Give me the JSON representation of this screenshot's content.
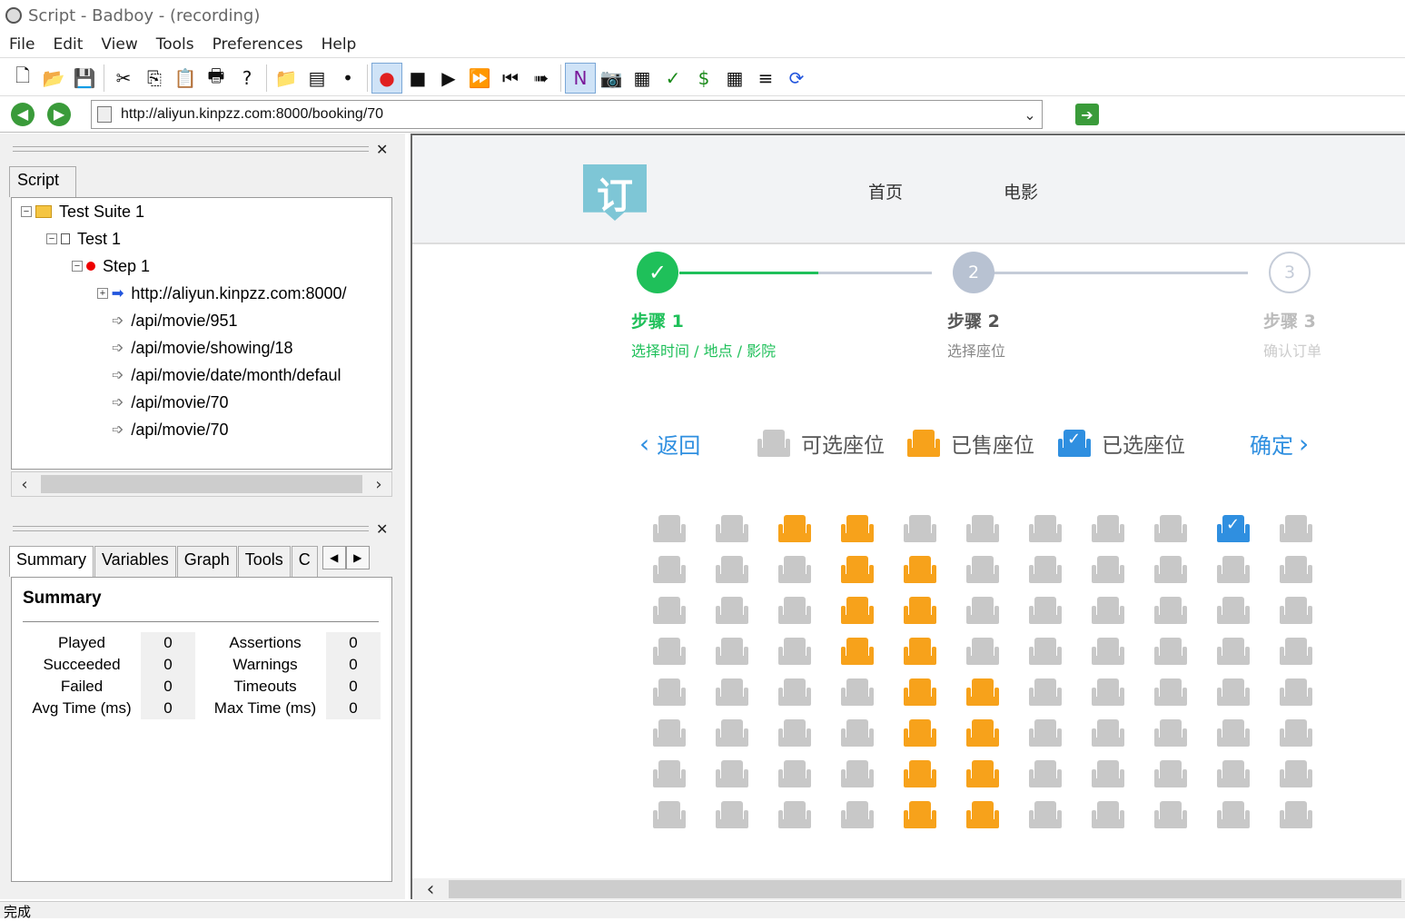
{
  "window": {
    "title": "Script - Badboy - (recording)"
  },
  "menu": [
    "File",
    "Edit",
    "View",
    "Tools",
    "Preferences",
    "Help"
  ],
  "toolbar": {
    "icons": [
      "new-file-icon",
      "open-folder-icon",
      "save-icon",
      "cut-icon",
      "copy-icon",
      "paste-icon",
      "print-icon",
      "help-icon",
      "add-folder-icon",
      "add-test-icon",
      "add-step-icon",
      "record-icon",
      "stop-icon",
      "play-icon",
      "fast-forward-icon",
      "rewind-icon",
      "step-forward-icon",
      "navigation-icon",
      "screenshot-icon",
      "form-icon",
      "check-icon",
      "dollar-icon",
      "table-icon",
      "report-icon",
      "refresh-icon"
    ],
    "glyphs": [
      "🗋",
      "📂",
      "💾",
      "✂",
      "⎘",
      "📋",
      "🖶",
      "?",
      "📁",
      "▤",
      "•",
      "●",
      "■",
      "▶",
      "⏩",
      "⏮",
      "➠",
      "N",
      "📷",
      "▦",
      "✓",
      "$",
      "▦",
      "≡",
      "⟳"
    ]
  },
  "address": {
    "url": "http://aliyun.kinpzz.com:8000/booking/70"
  },
  "script_panel": {
    "tab": "Script",
    "tree": [
      {
        "label": "Test Suite 1",
        "level": 0,
        "type": "folder",
        "expander": "−"
      },
      {
        "label": "Test 1",
        "level": 1,
        "type": "test",
        "expander": "−"
      },
      {
        "label": "Step 1",
        "level": 2,
        "type": "step",
        "expander": "−"
      },
      {
        "label": "http://aliyun.kinpzz.com:8000/",
        "level": 3,
        "type": "link",
        "expander": "+"
      },
      {
        "label": "/api/movie/951",
        "level": 3,
        "type": "request",
        "expander": ""
      },
      {
        "label": "/api/movie/showing/18",
        "level": 3,
        "type": "request",
        "expander": ""
      },
      {
        "label": "/api/movie/date/month/defaul",
        "level": 3,
        "type": "request",
        "expander": ""
      },
      {
        "label": "/api/movie/70",
        "level": 3,
        "type": "request",
        "expander": ""
      },
      {
        "label": "/api/movie/70",
        "level": 3,
        "type": "request",
        "expander": ""
      }
    ]
  },
  "summary_panel": {
    "tabs": [
      "Summary",
      "Variables",
      "Graph",
      "Tools",
      "C"
    ],
    "title": "Summary",
    "left": [
      {
        "label": "Played",
        "value": "0"
      },
      {
        "label": "Succeeded",
        "value": "0"
      },
      {
        "label": "Failed",
        "value": "0"
      },
      {
        "label": "Avg Time (ms)",
        "value": "0"
      }
    ],
    "right": [
      {
        "label": "Assertions",
        "value": "0"
      },
      {
        "label": "Warnings",
        "value": "0"
      },
      {
        "label": "Timeouts",
        "value": "0"
      },
      {
        "label": "Max Time (ms)",
        "value": "0"
      }
    ]
  },
  "webpage": {
    "logo_char": "订",
    "nav": [
      "首页",
      "电影"
    ],
    "steps": [
      {
        "number": "✓",
        "title": "步骤 1",
        "subtitle": "选择时间 / 地点 / 影院",
        "state": "done"
      },
      {
        "number": "2",
        "title": "步骤 2",
        "subtitle": "选择座位",
        "state": "current"
      },
      {
        "number": "3",
        "title": "步骤 3",
        "subtitle": "确认订单",
        "state": "todo"
      }
    ],
    "back_label": "返回",
    "confirm_label": "确定",
    "legend": {
      "available": "可选座位",
      "sold": "已售座位",
      "selected": "已选座位"
    },
    "colors": {
      "green": "#1fc05a",
      "orange": "#f7a21b",
      "blue": "#2f8fe0",
      "gray": "#c8c8c8"
    },
    "seat_map": [
      "AASSAAAAASA",
      "AAASSAAAAAA",
      "AAASSAAAAAA",
      "AAASSAAAAAA",
      "AAAASSAAAAA",
      "AAAASSAAAAA",
      "AAAASSAAAAA",
      "AAAASSAAAAA"
    ],
    "selected_seat": {
      "row": 1,
      "col": 10
    }
  },
  "status": {
    "text": "完成"
  }
}
